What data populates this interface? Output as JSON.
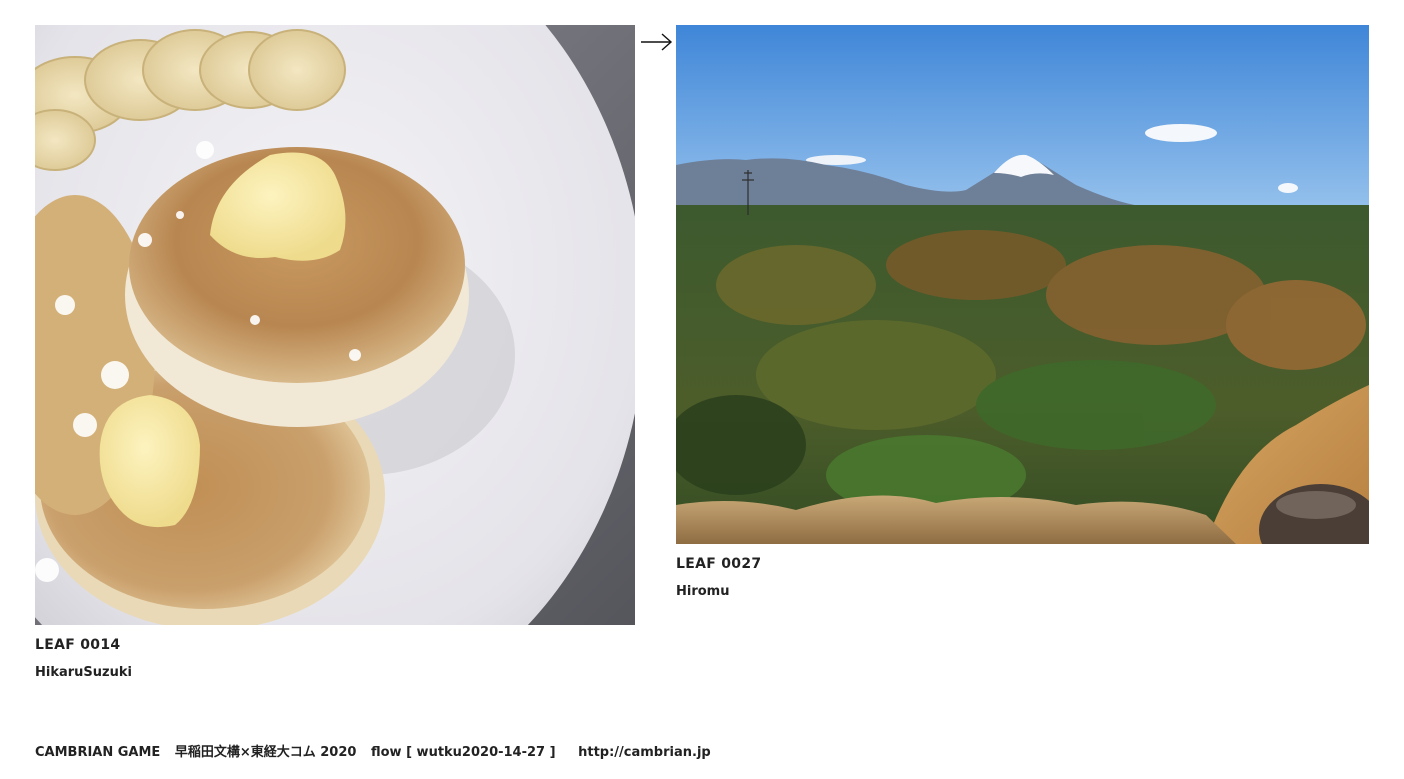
{
  "leaves": [
    {
      "id_label": "LEAF 0014",
      "author": "HikaruSuzuki",
      "image_subject": "pancakes-with-butter-and-banana"
    },
    {
      "id_label": "LEAF 0027",
      "author": "Hiromu",
      "image_subject": "forest-valley-with-mount-fuji"
    }
  ],
  "navigation": {
    "arrow_icon": "right-arrow-icon"
  },
  "footer": {
    "site_name": "CAMBRIAN GAME",
    "course": "早稲田文構×東経大コム 2020",
    "session": "flow [ wutku2020-14-27 ]",
    "url": "http://cambrian.jp"
  }
}
